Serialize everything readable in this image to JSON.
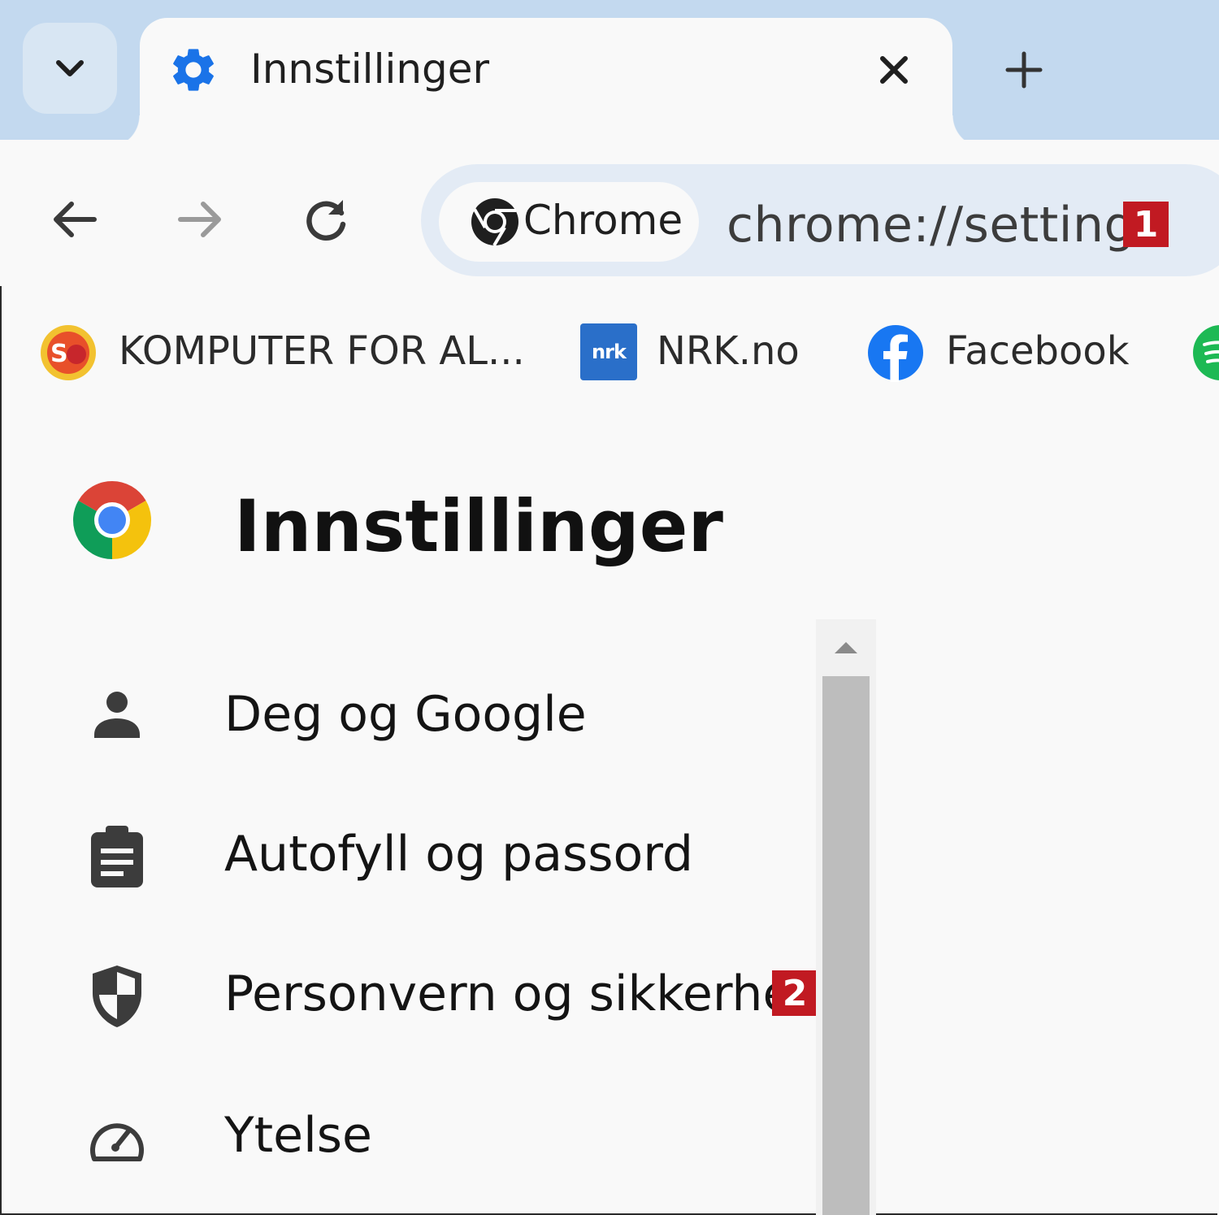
{
  "tab": {
    "title": "Innstillinger",
    "close_icon": "close-icon",
    "settings_icon": "gear-icon"
  },
  "tabstrip": {
    "search_tabs_icon": "chevron-down-icon",
    "new_tab_icon": "plus-icon"
  },
  "toolbar": {
    "back_icon": "arrow-left-icon",
    "forward_icon": "arrow-right-icon",
    "reload_icon": "reload-icon",
    "chip_label": "Chrome",
    "url": "chrome://settings",
    "badge": "1"
  },
  "bookmarks": [
    {
      "label": "KOMPUTER FOR AL...",
      "icon": "komputer-logo-icon"
    },
    {
      "label": "NRK.no",
      "icon": "nrk-logo-icon",
      "icon_text": "nrk"
    },
    {
      "label": "Facebook",
      "icon": "facebook-icon"
    }
  ],
  "settings": {
    "title": "Innstillinger",
    "menu": [
      {
        "label": "Deg og Google",
        "icon": "person-icon"
      },
      {
        "label": "Autofyll og passord",
        "icon": "clipboard-icon"
      },
      {
        "label": "Personvern og sikkerhet",
        "icon": "shield-icon",
        "badge": "2"
      },
      {
        "label": "Ytelse",
        "icon": "speedometer-icon"
      }
    ]
  },
  "colors": {
    "tabstrip": "#c3d9ef",
    "omnibox": "#e3ebf5",
    "accent_blue": "#1a73e8",
    "badge_red": "#c11a22"
  }
}
